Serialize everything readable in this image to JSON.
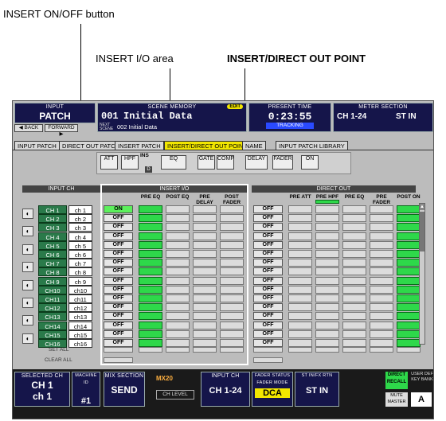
{
  "callouts": {
    "insert_onoff": "INSERT ON/OFF button",
    "insert_io": "INSERT I/O area",
    "insert_direct": "INSERT/DIRECT OUT POINT"
  },
  "topbar": {
    "input_label": "INPUT",
    "patch_label": "PATCH",
    "back": "◀ BACK",
    "forward": "FORWARD ▶",
    "scene_memory_label": "SCENE MEMORY",
    "edit_badge": "EDIT",
    "scene_number": "001",
    "scene_title": "Initial Data",
    "next_scene_label": "NEXT SCENE",
    "next_scene": "002 Initial Data",
    "present_time_label": "PRESENT TIME",
    "time": "0:23:55",
    "tracking": "TRACKING",
    "meter_label": "METER SECTION",
    "meter_ch": "CH 1-24",
    "meter_st": "ST IN"
  },
  "tabs": [
    "INPUT PATCH",
    "DIRECT OUT PATCH",
    "INSERT PATCH",
    "INSERT/DIRECT OUT POINT",
    "NAME",
    "INPUT PATCH LIBRARY"
  ],
  "chain": {
    "att": "ATT",
    "hpf": "HPF",
    "ins": "INS",
    "d": "D",
    "eq": "EQ",
    "gate": "GATE",
    "comp": "COMP",
    "delay": "DELAY",
    "fader": "FADER",
    "on": "ON"
  },
  "sections": {
    "input_ch": "INPUT CH",
    "insert_io": "INSERT I/O",
    "direct_out": "DIRECT OUT"
  },
  "insert_headers": [
    "PRE EQ",
    "POST EQ",
    "PRE DELAY",
    "POST FADER"
  ],
  "direct_headers": [
    "PRE ATT",
    "PRE HPF",
    "PRE EQ",
    "PRE FADER",
    "POST ON"
  ],
  "channels": [
    {
      "name": "CH 1",
      "short": "ch 1",
      "insert": "ON",
      "direct": "OFF"
    },
    {
      "name": "CH 2",
      "short": "ch 2",
      "insert": "OFF",
      "direct": "OFF"
    },
    {
      "name": "CH 3",
      "short": "ch 3",
      "insert": "OFF",
      "direct": "OFF"
    },
    {
      "name": "CH 4",
      "short": "ch 4",
      "insert": "OFF",
      "direct": "OFF"
    },
    {
      "name": "CH 5",
      "short": "ch 5",
      "insert": "OFF",
      "direct": "OFF"
    },
    {
      "name": "CH 6",
      "short": "ch 6",
      "insert": "OFF",
      "direct": "OFF"
    },
    {
      "name": "CH 7",
      "short": "ch 7",
      "insert": "OFF",
      "direct": "OFF"
    },
    {
      "name": "CH 8",
      "short": "ch 8",
      "insert": "OFF",
      "direct": "OFF"
    },
    {
      "name": "CH 9",
      "short": "ch 9",
      "insert": "OFF",
      "direct": "OFF"
    },
    {
      "name": "CH10",
      "short": "ch10",
      "insert": "OFF",
      "direct": "OFF"
    },
    {
      "name": "CH11",
      "short": "ch11",
      "insert": "OFF",
      "direct": "OFF"
    },
    {
      "name": "CH12",
      "short": "ch12",
      "insert": "OFF",
      "direct": "OFF"
    },
    {
      "name": "CH13",
      "short": "ch13",
      "insert": "OFF",
      "direct": "OFF"
    },
    {
      "name": "CH14",
      "short": "ch14",
      "insert": "OFF",
      "direct": "OFF"
    },
    {
      "name": "CH15",
      "short": "ch15",
      "insert": "OFF",
      "direct": "OFF"
    },
    {
      "name": "CH16",
      "short": "ch16",
      "insert": "OFF",
      "direct": "OFF"
    }
  ],
  "insert_selected_index": 0,
  "direct_selected_index": 4,
  "set_all": "SET ALL",
  "clear_all": "CLEAR ALL",
  "bottom": {
    "selected_ch_label": "SELECTED CH",
    "selected_ch": "CH 1",
    "selected_ch_name": "ch 1",
    "machine_id_label": "MACHINE ID",
    "machine_id": "#1",
    "mix_section_label": "MIX SECTION",
    "mix_mode": "SEND",
    "mix_name": "MX20",
    "ch_level": "CH LEVEL",
    "input_ch_label": "INPUT CH",
    "input_ch": "CH 1-24",
    "fader_status_label": "FADER STATUS",
    "fader_mode_label": "FADER MODE",
    "fader_mode": "DCA",
    "st_in_label": "ST IN/FX RTN",
    "st_in": "ST IN",
    "direct_recall": "DIRECT RECALL",
    "user_def": "USER DEF KEY BANK",
    "mute_master": "MUTE MASTER",
    "bank": "A"
  },
  "colors": {
    "accent_yellow": "#f2e600",
    "selected_green": "#2ed84a",
    "on_green": "#5cf05c",
    "channel_green": "#2a7a4a",
    "panel_navy": "#15154a"
  }
}
